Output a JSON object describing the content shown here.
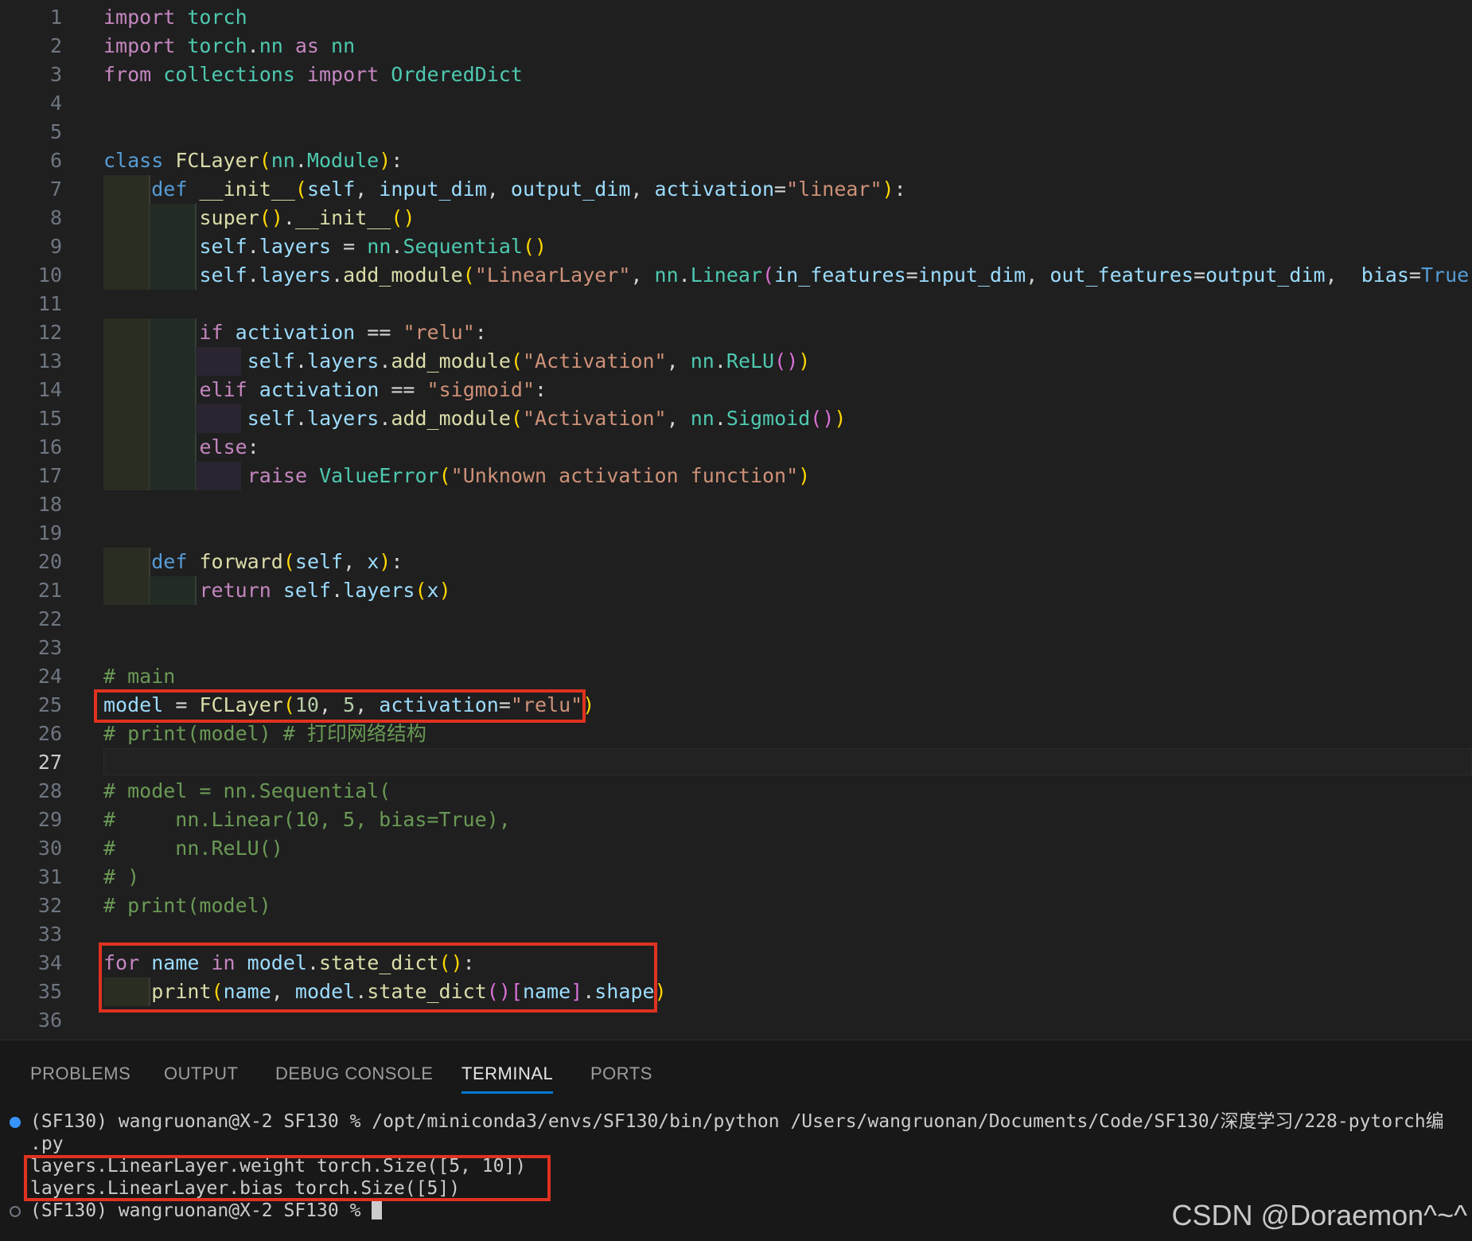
{
  "editor": {
    "active_line": "27",
    "lines": [
      {
        "n": "1",
        "t": "import torch"
      },
      {
        "n": "2",
        "t": "import torch.nn as nn"
      },
      {
        "n": "3",
        "t": "from collections import OrderedDict"
      },
      {
        "n": "4",
        "t": ""
      },
      {
        "n": "5",
        "t": ""
      },
      {
        "n": "6",
        "t": "class FCLayer(nn.Module):"
      },
      {
        "n": "7",
        "t": "    def __init__(self, input_dim, output_dim, activation=\"linear\"):"
      },
      {
        "n": "8",
        "t": "        super().__init__()"
      },
      {
        "n": "9",
        "t": "        self.layers = nn.Sequential()"
      },
      {
        "n": "10",
        "t": "        self.layers.add_module(\"LinearLayer\", nn.Linear(in_features=input_dim, out_features=output_dim,  bias=True))"
      },
      {
        "n": "11",
        "t": ""
      },
      {
        "n": "12",
        "t": "        if activation == \"relu\":"
      },
      {
        "n": "13",
        "t": "            self.layers.add_module(\"Activation\", nn.ReLU())"
      },
      {
        "n": "14",
        "t": "        elif activation == \"sigmoid\":"
      },
      {
        "n": "15",
        "t": "            self.layers.add_module(\"Activation\", nn.Sigmoid())"
      },
      {
        "n": "16",
        "t": "        else:"
      },
      {
        "n": "17",
        "t": "            raise ValueError(\"Unknown activation function\")"
      },
      {
        "n": "18",
        "t": ""
      },
      {
        "n": "19",
        "t": ""
      },
      {
        "n": "20",
        "t": "    def forward(self, x):"
      },
      {
        "n": "21",
        "t": "        return self.layers(x)"
      },
      {
        "n": "22",
        "t": ""
      },
      {
        "n": "23",
        "t": ""
      },
      {
        "n": "24",
        "t": "# main"
      },
      {
        "n": "25",
        "t": "model = FCLayer(10, 5, activation=\"relu\")"
      },
      {
        "n": "26",
        "t": "# print(model) # 打印网络结构"
      },
      {
        "n": "27",
        "t": ""
      },
      {
        "n": "28",
        "t": "# model = nn.Sequential("
      },
      {
        "n": "29",
        "t": "#     nn.Linear(10, 5, bias=True),"
      },
      {
        "n": "30",
        "t": "#     nn.ReLU()"
      },
      {
        "n": "31",
        "t": "# )"
      },
      {
        "n": "32",
        "t": "# print(model)"
      },
      {
        "n": "33",
        "t": ""
      },
      {
        "n": "34",
        "t": "for name in model.state_dict():"
      },
      {
        "n": "35",
        "t": "    print(name, model.state_dict()[name].shape)"
      },
      {
        "n": "36",
        "t": ""
      }
    ]
  },
  "panel": {
    "tabs": [
      "PROBLEMS",
      "OUTPUT",
      "DEBUG CONSOLE",
      "TERMINAL",
      "PORTS"
    ],
    "active_tab": "TERMINAL",
    "terminal": {
      "line1": "(SF130) wangruonan@X-2 SF130 % /opt/miniconda3/envs/SF130/bin/python /Users/wangruonan/Documents/Code/SF130/深度学习/228-pytorch编",
      "line2": ".py",
      "line3": "layers.LinearLayer.weight torch.Size([5, 10])",
      "line4": "layers.LinearLayer.bias torch.Size([5])",
      "line5": "(SF130) wangruonan@X-2 SF130 % "
    },
    "colors": {
      "dot_done": "#3794ff",
      "dot_idle": "#6e7681"
    }
  },
  "watermark": "CSDN @Doraemon^~^"
}
